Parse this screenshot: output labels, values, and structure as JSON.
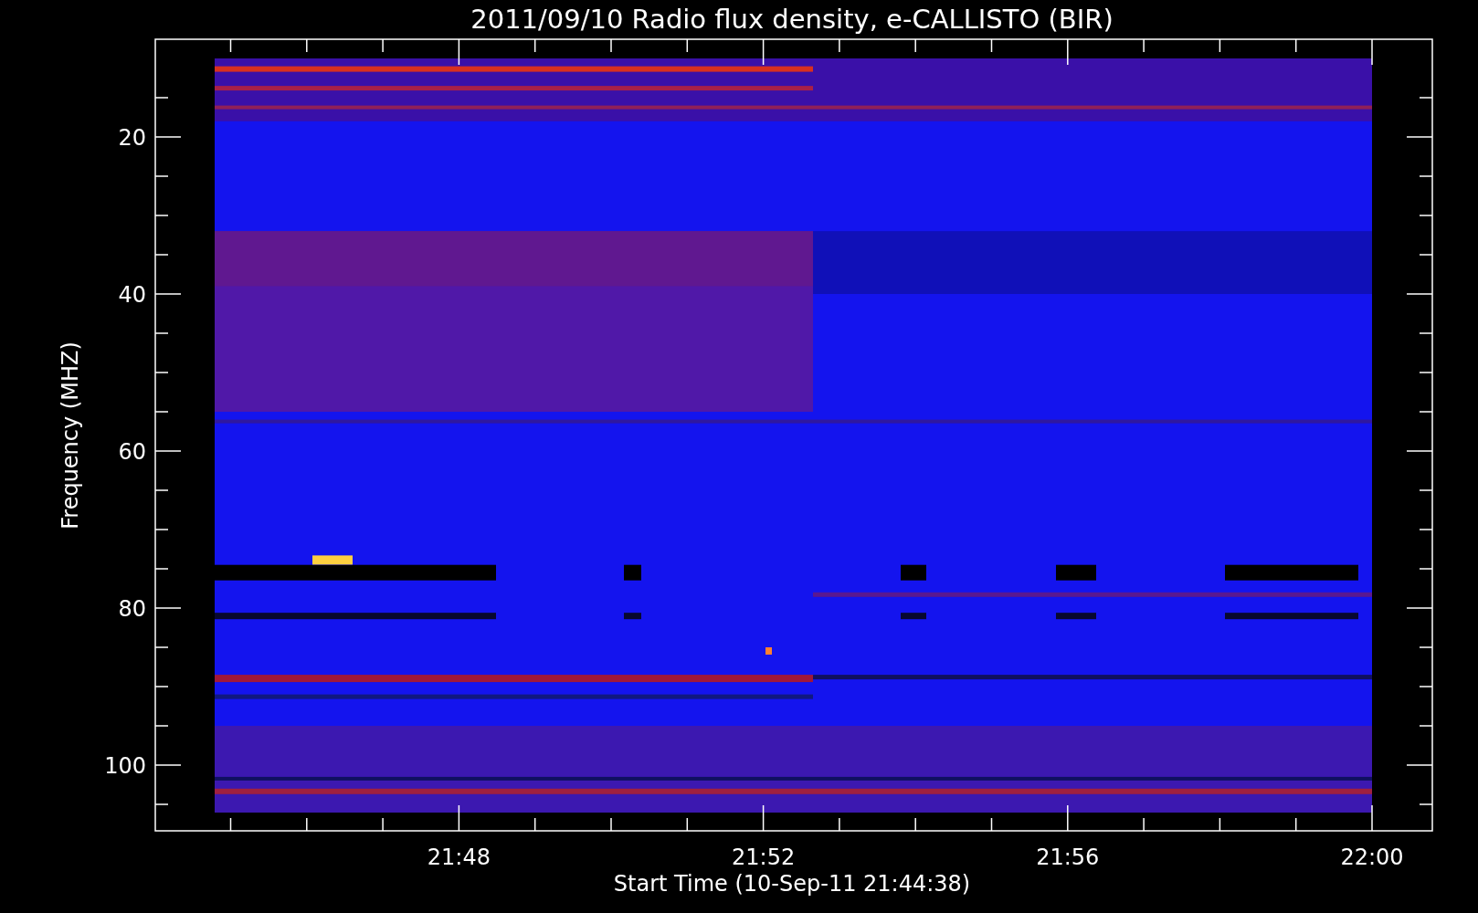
{
  "title": "2011/09/10  Radio flux density, e-CALLISTO (BIR)",
  "y_axis": {
    "label": "Frequency (MHZ)",
    "ticks": [
      "20",
      "40",
      "60",
      "80",
      "100"
    ]
  },
  "x_axis": {
    "label": "Start Time (10-Sep-11 21:44:38)",
    "ticks": [
      "21:48",
      "21:52",
      "21:56",
      "22:00"
    ]
  }
}
